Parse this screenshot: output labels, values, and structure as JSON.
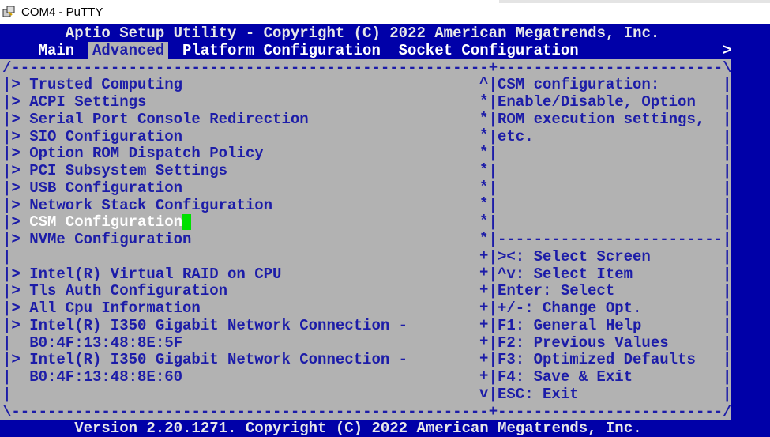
{
  "window": {
    "title": "COM4 - PuTTY"
  },
  "header": {
    "title": "Aptio Setup Utility - Copyright (C) 2022 American Megatrends, Inc."
  },
  "tabs": [
    {
      "label": "Main",
      "active": false
    },
    {
      "label": "Advanced",
      "active": true
    },
    {
      "label": "Platform Configuration",
      "active": false
    },
    {
      "label": "Socket Configuration",
      "active": false
    }
  ],
  "tabs_more": ">",
  "menu_items": [
    {
      "label": "Trusted Computing",
      "submenu": true
    },
    {
      "label": "ACPI Settings",
      "submenu": true
    },
    {
      "label": "Serial Port Console Redirection",
      "submenu": true
    },
    {
      "label": "SIO Configuration",
      "submenu": true
    },
    {
      "label": "Option ROM Dispatch Policy",
      "submenu": true
    },
    {
      "label": "PCI Subsystem Settings",
      "submenu": true
    },
    {
      "label": "USB Configuration",
      "submenu": true
    },
    {
      "label": "Network Stack Configuration",
      "submenu": true
    },
    {
      "label": "CSM Configuration",
      "submenu": true,
      "selected": true
    },
    {
      "label": "NVMe Configuration",
      "submenu": true
    },
    {
      "label": "",
      "submenu": false
    },
    {
      "label": "Intel(R) Virtual RAID on CPU",
      "submenu": true
    },
    {
      "label": "Tls Auth Configuration",
      "submenu": true
    },
    {
      "label": "All Cpu Information",
      "submenu": true
    },
    {
      "label": "Intel(R) I350 Gigabit Network Connection -",
      "submenu": true
    },
    {
      "label": "B0:4F:13:48:8E:5F",
      "submenu": false
    },
    {
      "label": "Intel(R) I350 Gigabit Network Connection -",
      "submenu": true
    },
    {
      "label": "B0:4F:13:48:8E:60",
      "submenu": false
    },
    {
      "label": "",
      "submenu": false
    }
  ],
  "scroll_indicators": "^*********++++++++v ",
  "help_text": [
    "CSM configuration:",
    "Enable/Disable, Option",
    "ROM execution settings,",
    "etc."
  ],
  "key_hints": [
    "><: Select Screen",
    "^v: Select Item",
    "Enter: Select",
    "+/-: Change Opt.",
    "F1: General Help",
    "F2: Previous Values",
    "F3: Optimized Defaults",
    "F4: Save & Exit",
    "ESC: Exit"
  ],
  "footer": {
    "version": "Version 2.20.1271. Copyright (C) 2022 American Megatrends, Inc."
  },
  "colors": {
    "background": "#0000a8",
    "panel": "#b2b2b2",
    "text": "#1c1ca8",
    "cursor": "#00e000"
  }
}
